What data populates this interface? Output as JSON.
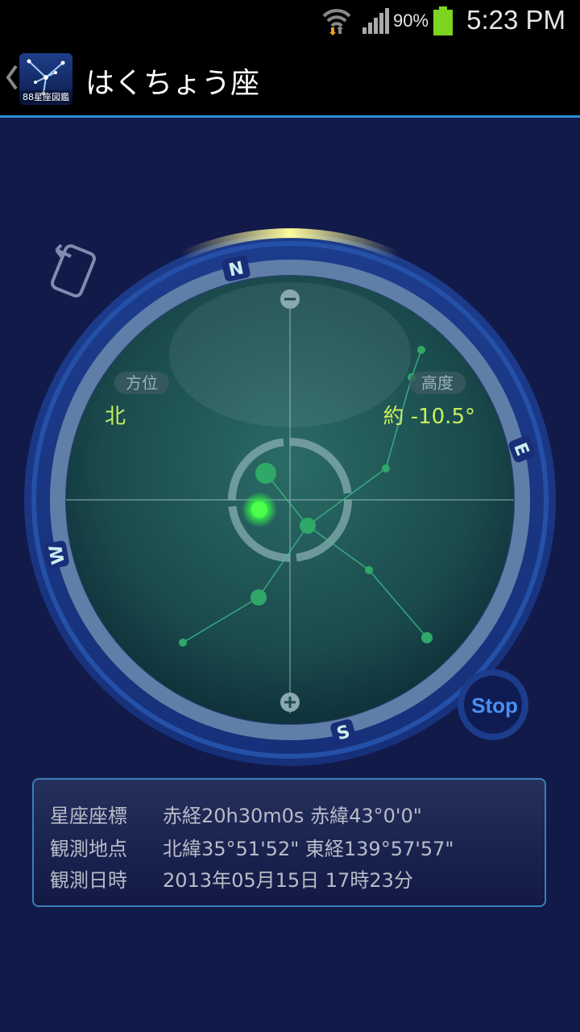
{
  "status_bar": {
    "time": "5:23 PM",
    "battery_percent": "90%",
    "icons": [
      "wifi-icon",
      "signal-icon",
      "battery-icon"
    ]
  },
  "action_bar": {
    "title": "はくちょう座",
    "app_icon_label": "88星座図鑑"
  },
  "compass": {
    "directions": {
      "north": "N",
      "east": "E",
      "south": "S",
      "west": "W"
    },
    "azimuth_label": "方位",
    "azimuth_value": "北",
    "altitude_label": "高度",
    "altitude_value": "約 -10.5°",
    "stop_label": "Stop"
  },
  "info": {
    "rows": [
      {
        "key": "星座座標",
        "value": "赤経20h30m0s 赤緯43°0'0\""
      },
      {
        "key": "観測地点",
        "value": "北緯35°51'52\" 東経139°57'57\""
      },
      {
        "key": "観測日時",
        "value": "2013年05月15日 17時23分"
      }
    ]
  },
  "colors": {
    "background": "#121a4a",
    "accent": "#2a8ed8",
    "label_green": "#c8f060",
    "star_green": "#2fd870"
  }
}
